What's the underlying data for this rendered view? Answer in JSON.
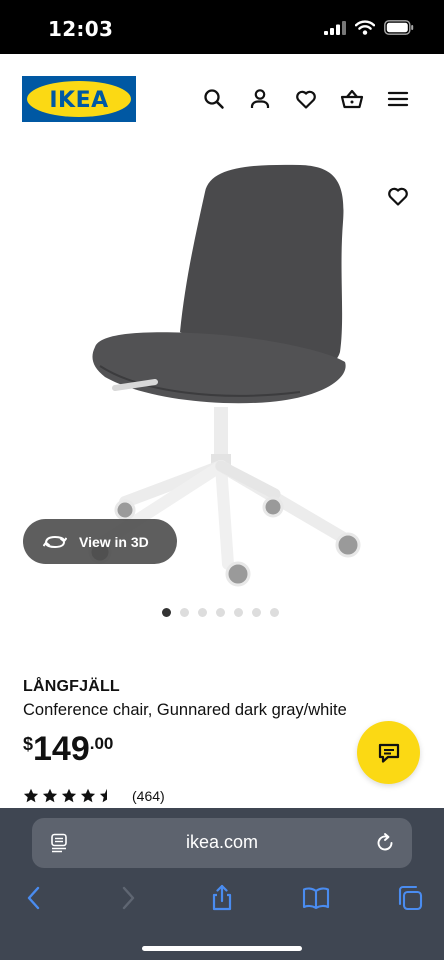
{
  "status_bar": {
    "time": "12:03"
  },
  "header": {
    "logo_text": "IKEA"
  },
  "gallery": {
    "view_3d_label": "View in 3D",
    "dot_count": 7,
    "active_dot": 0
  },
  "product": {
    "name": "LÅNGFJÄLL",
    "description": "Conference chair, Gunnared dark gray/white",
    "price_currency": "$",
    "price_main": "149",
    "price_cents": ".00",
    "rating_value": 4.5,
    "review_count": "(464)"
  },
  "browser": {
    "url": "ikea.com"
  },
  "colors": {
    "ikea_blue": "#0058a3",
    "ikea_yellow": "#fbd914",
    "browser_bar": "#3f4652",
    "ios_blue": "#4a8cf0"
  }
}
